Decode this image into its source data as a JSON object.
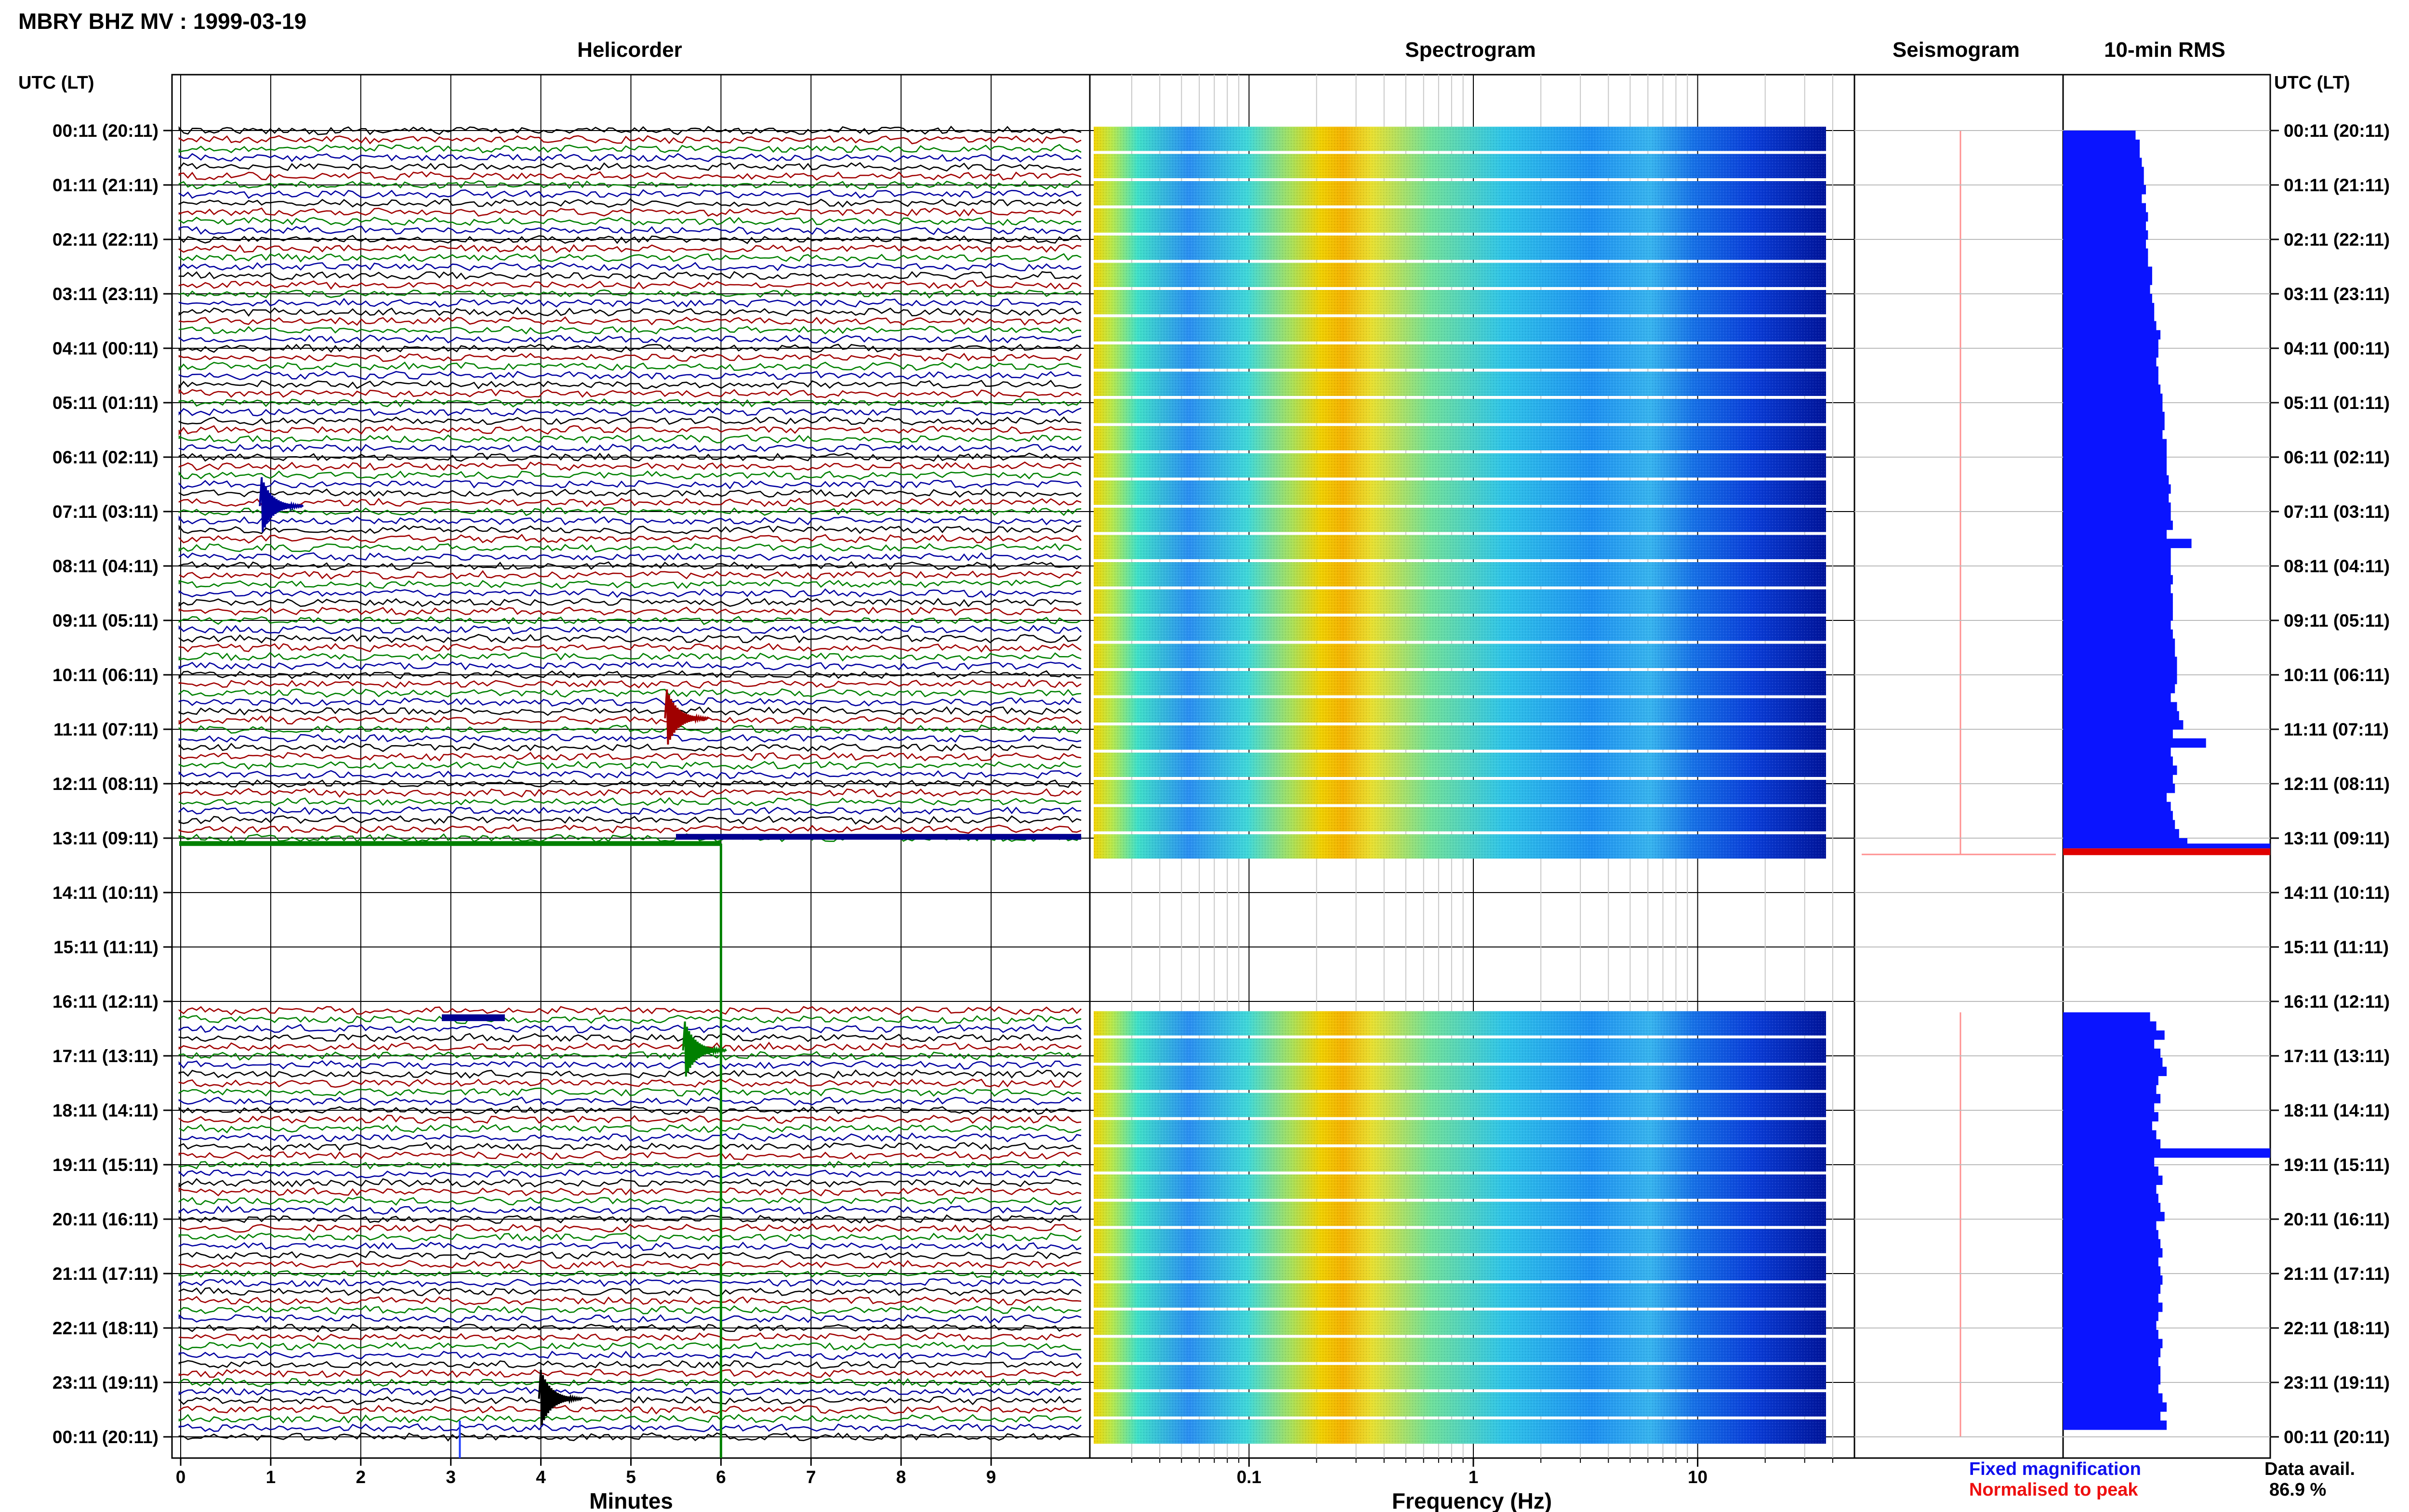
{
  "header": {
    "station_title": "MBRY BHZ MV : 1999-03-19"
  },
  "panels": {
    "helicorder_title": "Helicorder",
    "spectrogram_title": "Spectrogram",
    "seismogram_title": "Seismogram",
    "rms_title": "10-min RMS"
  },
  "axes": {
    "time_axis_label_left": "UTC (LT)",
    "time_axis_label_right": "UTC (LT)",
    "helicorder_xlabel": "Minutes",
    "spectrogram_xlabel": "Frequency (Hz)"
  },
  "legend": {
    "fixed_magnification": "Fixed magnification",
    "normalised_to_peak": "Normalised to peak",
    "data_avail_label": "Data avail.",
    "data_avail_value": "86.9 %",
    "fixed_color": "#1010ee",
    "normalised_color": "#ee1010"
  },
  "colors": {
    "trace_cycle": [
      "#000000",
      "#a00000",
      "#008000",
      "#0000a0"
    ],
    "rms_bar": "#0a14ff",
    "rms_peak_bar": "#e00000",
    "seismogram_marker": "#ff9090",
    "grid": "#c8c8c8"
  },
  "chart_data": [
    {
      "type": "line",
      "name": "helicorder",
      "title": "Helicorder",
      "xlabel": "Minutes",
      "xlim": [
        0,
        10
      ],
      "xticks": [
        0,
        1,
        2,
        3,
        4,
        5,
        6,
        7,
        8,
        9
      ],
      "row_labels": [
        "00:11 (20:11)",
        "01:11 (21:11)",
        "02:11 (22:11)",
        "03:11 (23:11)",
        "04:11 (00:11)",
        "05:11 (01:11)",
        "06:11 (02:11)",
        "07:11 (03:11)",
        "08:11 (04:11)",
        "09:11 (05:11)",
        "10:11 (06:11)",
        "11:11 (07:11)",
        "12:11 (08:11)",
        "13:11 (09:11)",
        "14:11 (10:11)",
        "15:11 (11:11)",
        "16:11 (12:11)",
        "17:11 (13:11)",
        "18:11 (14:11)",
        "19:11 (15:11)",
        "20:11 (16:11)",
        "21:11 (17:11)",
        "22:11 (18:11)",
        "23:11 (19:11)",
        "00:11 (20:11)"
      ],
      "traces_per_hour": 6,
      "data_gap_hours": [
        13.1,
        16.2
      ],
      "events": [
        {
          "hour": 6.9,
          "minute": 0.9
        },
        {
          "hour": 10.8,
          "minute": 5.4
        },
        {
          "hour": 16.9,
          "minute": 5.6
        },
        {
          "hour": 23.3,
          "minute": 4.0
        }
      ]
    },
    {
      "type": "heatmap",
      "name": "spectrogram",
      "title": "Spectrogram",
      "xlabel": "Frequency (Hz)",
      "xscale": "log",
      "xlim": [
        0.02,
        50
      ],
      "xticks": [
        0.1,
        1,
        10
      ],
      "xtick_labels": [
        "0.1",
        "1",
        "10"
      ],
      "colormap": "jet",
      "peak_band_hz": [
        0.2,
        0.3
      ],
      "data_gap_hours": [
        13.1,
        16.2
      ]
    },
    {
      "type": "line",
      "name": "seismogram",
      "title": "Seismogram",
      "marker_color": "#ff9090"
    },
    {
      "type": "bar",
      "name": "rms",
      "title": "10-min RMS",
      "orientation": "horizontal",
      "data_gap_hours": [
        13.1,
        16.2
      ],
      "pre_gap_values": [
        0.35,
        0.37,
        0.37,
        0.38,
        0.39,
        0.39,
        0.4,
        0.38,
        0.4,
        0.41,
        0.4,
        0.41,
        0.4,
        0.41,
        0.41,
        0.43,
        0.43,
        0.42,
        0.43,
        0.44,
        0.44,
        0.45,
        0.47,
        0.46,
        0.46,
        0.45,
        0.46,
        0.46,
        0.47,
        0.48,
        0.48,
        0.49,
        0.49,
        0.48,
        0.5,
        0.5,
        0.5,
        0.5,
        0.51,
        0.52,
        0.51,
        0.52,
        0.52,
        0.53,
        0.5,
        0.62,
        0.52,
        0.52,
        0.52,
        0.53,
        0.52,
        0.53,
        0.53,
        0.53,
        0.52,
        0.53,
        0.54,
        0.54,
        0.55,
        0.55,
        0.55,
        0.54,
        0.52,
        0.55,
        0.56,
        0.58,
        0.53,
        0.69,
        0.52,
        0.53,
        0.55,
        0.53,
        0.54,
        0.5,
        0.52,
        0.53,
        0.54,
        0.56,
        0.6
      ],
      "post_gap_values": [
        0.42,
        0.45,
        0.49,
        0.44,
        0.47,
        0.48,
        0.5,
        0.46,
        0.45,
        0.47,
        0.44,
        0.46,
        0.43,
        0.45,
        0.47,
        1.0,
        0.44,
        0.46,
        0.48,
        0.45,
        0.46,
        0.47,
        0.49,
        0.45,
        0.46,
        0.47,
        0.48,
        0.46,
        0.47,
        0.48,
        0.47,
        0.46,
        0.48,
        0.46,
        0.45,
        0.46,
        0.48,
        0.47,
        0.46,
        0.47,
        0.47,
        0.46,
        0.48,
        0.5,
        0.47,
        0.5
      ],
      "peak_value": 1.0
    }
  ]
}
